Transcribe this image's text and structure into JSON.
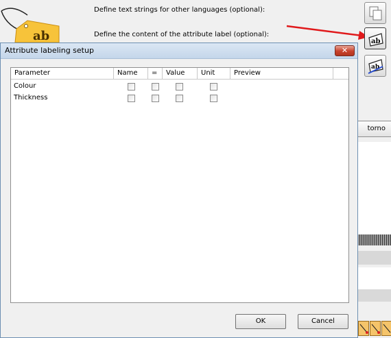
{
  "background": {
    "line1": "Define text strings for other languages (optional):",
    "line2": "Define the content of the attribute label (optional):",
    "retorno_label": "torno"
  },
  "dialog": {
    "title": "Attribute labeling setup",
    "close_glyph": "✕",
    "columns": [
      "Parameter",
      "Name",
      "=",
      "Value",
      "Unit",
      "Preview"
    ],
    "rows": [
      {
        "parameter": "Colour",
        "name": false,
        "eq": false,
        "value": false,
        "unit": false,
        "preview": ""
      },
      {
        "parameter": "Thickness",
        "name": false,
        "eq": false,
        "value": false,
        "unit": false,
        "preview": ""
      }
    ],
    "ok_label": "OK",
    "cancel_label": "Cancel"
  },
  "colors": {
    "arrow": "#e0191b",
    "tag": "#f7c33a",
    "close_button": "#c8412b"
  },
  "icons": [
    "tag-icon",
    "copy-icon",
    "attribute-label-icon",
    "edit-label-icon"
  ]
}
